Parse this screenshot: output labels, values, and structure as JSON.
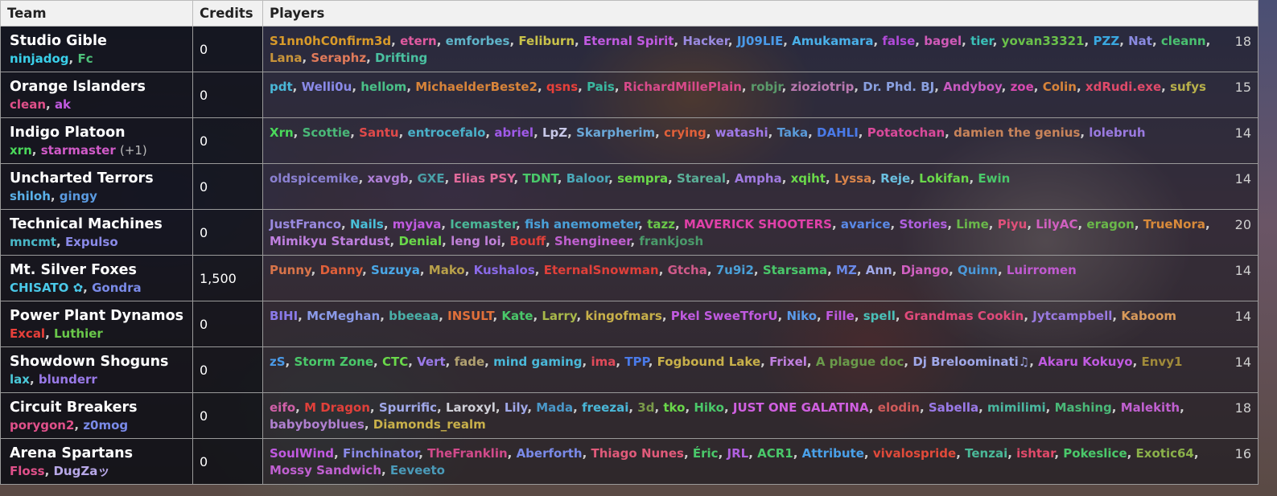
{
  "headers": {
    "team": "Team",
    "credits": "Credits",
    "players": "Players"
  },
  "rows": [
    {
      "team": "Studio Gible",
      "captains": [
        {
          "name": "ninjadog",
          "color": "#3ad0ea"
        },
        {
          "name": "Fc",
          "color": "#4ec07a"
        }
      ],
      "credits": "0",
      "players": [
        {
          "name": "S1nn0hC0nfirm3d",
          "color": "#d89a2a"
        },
        {
          "name": "etern",
          "color": "#e05aa0"
        },
        {
          "name": "emforbes",
          "color": "#5fb3c8"
        },
        {
          "name": "Feliburn",
          "color": "#c9c24a"
        },
        {
          "name": "Eternal Spirit",
          "color": "#c05ae0"
        },
        {
          "name": "Hacker",
          "color": "#9a8ae0"
        },
        {
          "name": "JJ09LIE",
          "color": "#4a9ae8"
        },
        {
          "name": "Amukamara",
          "color": "#4ab0e8"
        },
        {
          "name": "false",
          "color": "#b04ad8"
        },
        {
          "name": "bagel",
          "color": "#d05ab8"
        },
        {
          "name": "tier",
          "color": "#3ac0b8"
        },
        {
          "name": "yovan33321",
          "color": "#6ac04a"
        },
        {
          "name": "PZZ",
          "color": "#3aa8e0"
        },
        {
          "name": "Nat",
          "color": "#8a8ae0"
        },
        {
          "name": "cleann",
          "color": "#4ac070"
        },
        {
          "name": "Lana",
          "color": "#c8943a"
        },
        {
          "name": "Seraphz",
          "color": "#e07a5a"
        },
        {
          "name": "Drifting",
          "color": "#4ac0a0"
        }
      ],
      "count": "18"
    },
    {
      "team": "Orange Islanders",
      "captains": [
        {
          "name": "clean",
          "color": "#e0508a"
        },
        {
          "name": "ak",
          "color": "#c05ae0"
        }
      ],
      "credits": "0",
      "players": [
        {
          "name": "pdt",
          "color": "#4ab8d8"
        },
        {
          "name": "Welli0u",
          "color": "#8a8ae8"
        },
        {
          "name": "hellom",
          "color": "#4ac088"
        },
        {
          "name": "MichaelderBeste2",
          "color": "#d8843a"
        },
        {
          "name": "qsns",
          "color": "#e8403a"
        },
        {
          "name": "Pais",
          "color": "#3ab8a0"
        },
        {
          "name": "RichardMillePlain",
          "color": "#d84a8a"
        },
        {
          "name": "robjr",
          "color": "#5a9a6a"
        },
        {
          "name": "zioziotrip",
          "color": "#b878b0"
        },
        {
          "name": "Dr. Phd. BJ",
          "color": "#8aa0e0"
        },
        {
          "name": "Andyboy",
          "color": "#c85ac0"
        },
        {
          "name": "zoe",
          "color": "#d84ab0"
        },
        {
          "name": "Colin",
          "color": "#d8843a"
        },
        {
          "name": "xdRudi.exe",
          "color": "#e04a6a"
        },
        {
          "name": "sufys",
          "color": "#b8b04a"
        }
      ],
      "count": "15"
    },
    {
      "team": "Indigo Platoon",
      "captains": [
        {
          "name": "xrn",
          "color": "#4ad85a"
        },
        {
          "name": "starmaster",
          "color": "#d05ac8"
        }
      ],
      "captains_extra": "(+1)",
      "credits": "0",
      "players": [
        {
          "name": "Xrn",
          "color": "#4ad85a"
        },
        {
          "name": "Scottie",
          "color": "#4ab878"
        },
        {
          "name": "Santu",
          "color": "#e04a4a"
        },
        {
          "name": "entrocefalo",
          "color": "#4ab0c8"
        },
        {
          "name": "abriel",
          "color": "#a05ae8"
        },
        {
          "name": "LpZ",
          "color": "#c8c8e8"
        },
        {
          "name": "Skarpherim",
          "color": "#6aa8d8"
        },
        {
          "name": "crying",
          "color": "#e0603a"
        },
        {
          "name": "watashi",
          "color": "#a07ae8"
        },
        {
          "name": "Taka",
          "color": "#5a9ad8"
        },
        {
          "name": "DAHLI",
          "color": "#4a7ae8"
        },
        {
          "name": "Potatochan",
          "color": "#d84a9a"
        },
        {
          "name": "damien the genius",
          "color": "#c8845a"
        },
        {
          "name": "lolebruh",
          "color": "#9a7ae0"
        }
      ],
      "count": "14"
    },
    {
      "team": "Uncharted Terrors",
      "captains": [
        {
          "name": "shiloh",
          "color": "#5ab0e8"
        },
        {
          "name": "gingy",
          "color": "#5a9ae0"
        }
      ],
      "credits": "0",
      "players": [
        {
          "name": "oldspicemike",
          "color": "#8a80d0"
        },
        {
          "name": "xavgb",
          "color": "#b080d8"
        },
        {
          "name": "GXE",
          "color": "#4aa0a8"
        },
        {
          "name": "Elias PSY",
          "color": "#e06a9a"
        },
        {
          "name": "TDNT",
          "color": "#4ac86a"
        },
        {
          "name": "Baloor",
          "color": "#4aa8b8"
        },
        {
          "name": "sempra",
          "color": "#6ad84a"
        },
        {
          "name": "Stareal",
          "color": "#5ab098"
        },
        {
          "name": "Ampha",
          "color": "#a07ae0"
        },
        {
          "name": "xqiht",
          "color": "#6ad84a"
        },
        {
          "name": "Lyssa",
          "color": "#d8844a"
        },
        {
          "name": "Reje",
          "color": "#6ac0e0"
        },
        {
          "name": "Lokifan",
          "color": "#6ad84a"
        },
        {
          "name": "Ewin",
          "color": "#4ac86a"
        }
      ],
      "count": "14"
    },
    {
      "team": "Technical Machines",
      "captains": [
        {
          "name": "mncmt",
          "color": "#4ab8c8"
        },
        {
          "name": "Expulso",
          "color": "#8a8ae8"
        }
      ],
      "credits": "0",
      "players": [
        {
          "name": "JustFranco",
          "color": "#9a8ae0"
        },
        {
          "name": "Nails",
          "color": "#4ac0d8"
        },
        {
          "name": "myjava",
          "color": "#c05ae0"
        },
        {
          "name": "Icemaster",
          "color": "#4ab898"
        },
        {
          "name": "fish anemometer",
          "color": "#4aa0d8"
        },
        {
          "name": "tazz",
          "color": "#6ac84a"
        },
        {
          "name": "MAVERICK SHOOTERS",
          "color": "#e040a8"
        },
        {
          "name": "avarice",
          "color": "#5a8ae8"
        },
        {
          "name": "Stories",
          "color": "#b060e0"
        },
        {
          "name": "Lime",
          "color": "#6ab84a"
        },
        {
          "name": "Piyu",
          "color": "#e0507a"
        },
        {
          "name": "LilyAC",
          "color": "#d060c0"
        },
        {
          "name": "eragon",
          "color": "#6ab84a"
        },
        {
          "name": "TrueNora",
          "color": "#d88a3a"
        },
        {
          "name": "Mimikyu Stardust",
          "color": "#c080e0"
        },
        {
          "name": "Denial",
          "color": "#6ad84a"
        },
        {
          "name": "leng loi",
          "color": "#c080d8"
        },
        {
          "name": "Bouff",
          "color": "#e0403a"
        },
        {
          "name": "Shengineer",
          "color": "#c060d0"
        },
        {
          "name": "frankjosh",
          "color": "#4a9a6a"
        }
      ],
      "count": "20"
    },
    {
      "team": "Mt. Silver Foxes",
      "captains": [
        {
          "name": "CHISATO ✿",
          "color": "#4ac8e8"
        },
        {
          "name": "Gondra",
          "color": "#7a8ae8"
        }
      ],
      "credits": "1,500",
      "players": [
        {
          "name": "Punny",
          "color": "#d8744a"
        },
        {
          "name": "Danny",
          "color": "#e0603a"
        },
        {
          "name": "Suzuya",
          "color": "#4aa8e8"
        },
        {
          "name": "Mako",
          "color": "#b8a04a"
        },
        {
          "name": "Kushalos",
          "color": "#8a6ae8"
        },
        {
          "name": "EternalSnowman",
          "color": "#e0403a"
        },
        {
          "name": "Gtcha",
          "color": "#d05a8a"
        },
        {
          "name": "7u9i2",
          "color": "#4aa0d8"
        },
        {
          "name": "Starsama",
          "color": "#4ac86a"
        },
        {
          "name": "MZ",
          "color": "#6a8ae8"
        },
        {
          "name": "Ann",
          "color": "#a0a8e8"
        },
        {
          "name": "Django",
          "color": "#d060c0"
        },
        {
          "name": "Quinn",
          "color": "#4a98d8"
        },
        {
          "name": "Luirromen",
          "color": "#c05ad0"
        }
      ],
      "count": "14"
    },
    {
      "team": "Power Plant Dynamos",
      "captains": [
        {
          "name": "Excal",
          "color": "#e8403a"
        },
        {
          "name": "Luthier",
          "color": "#6ac84a"
        }
      ],
      "credits": "0",
      "players": [
        {
          "name": "BIHI",
          "color": "#8a7ae8"
        },
        {
          "name": "McMeghan",
          "color": "#8a9ae8"
        },
        {
          "name": "bbeeaa",
          "color": "#4ab0a8"
        },
        {
          "name": "INSULT",
          "color": "#e0703a"
        },
        {
          "name": "Kate",
          "color": "#4ac86a"
        },
        {
          "name": "Larry",
          "color": "#a8b84a"
        },
        {
          "name": "kingofmars",
          "color": "#c8b04a"
        },
        {
          "name": "Pkel SweeTforU",
          "color": "#c05ae0"
        },
        {
          "name": "Niko",
          "color": "#5a9ae8"
        },
        {
          "name": "Fille",
          "color": "#c05ae0"
        },
        {
          "name": "spell",
          "color": "#4ac0b8"
        },
        {
          "name": "Grandmas Cookin",
          "color": "#e04a7a"
        },
        {
          "name": "Jytcampbell",
          "color": "#9a7ae0"
        },
        {
          "name": "Kaboom",
          "color": "#d89a5a"
        }
      ],
      "count": "14"
    },
    {
      "team": "Showdown Shoguns",
      "captains": [
        {
          "name": "lax",
          "color": "#4ac8d8"
        },
        {
          "name": "blunderr",
          "color": "#9a7ae8"
        }
      ],
      "credits": "0",
      "players": [
        {
          "name": "zS",
          "color": "#4a9ae8"
        },
        {
          "name": "Storm Zone",
          "color": "#4ac86a"
        },
        {
          "name": "CTC",
          "color": "#6ad84a"
        },
        {
          "name": "Vert",
          "color": "#9a7ae8"
        },
        {
          "name": "fade",
          "color": "#b0a070"
        },
        {
          "name": "mind gaming",
          "color": "#4ab8d8"
        },
        {
          "name": "ima",
          "color": "#e04a5a"
        },
        {
          "name": "TPP",
          "color": "#4a7ae8"
        },
        {
          "name": "Fogbound Lake",
          "color": "#c8b04a"
        },
        {
          "name": "Frixel",
          "color": "#c080e0"
        },
        {
          "name": "A plague doc",
          "color": "#6a9a4a"
        },
        {
          "name": "Dj Breloominati♫",
          "color": "#a0a8e8"
        },
        {
          "name": "Akaru Kokuyo",
          "color": "#c05ae0"
        },
        {
          "name": "Envy1",
          "color": "#a08a3a"
        }
      ],
      "count": "14"
    },
    {
      "team": "Circuit Breakers",
      "captains": [
        {
          "name": "porygon2",
          "color": "#e0508a"
        },
        {
          "name": "z0mog",
          "color": "#7a8ae8"
        }
      ],
      "credits": "0",
      "players": [
        {
          "name": "eifo",
          "color": "#d060a8"
        },
        {
          "name": "M Dragon",
          "color": "#e0403a"
        },
        {
          "name": "Spurrific",
          "color": "#a0a8e8"
        },
        {
          "name": "Laroxyl",
          "color": "#d0d0d8"
        },
        {
          "name": "Lily",
          "color": "#a0a8e8"
        },
        {
          "name": "Mada",
          "color": "#4a98c8"
        },
        {
          "name": "freezai",
          "color": "#4ab8d8"
        },
        {
          "name": "3d",
          "color": "#7a9a4a"
        },
        {
          "name": "tko",
          "color": "#6ad84a"
        },
        {
          "name": "Hiko",
          "color": "#4ac86a"
        },
        {
          "name": "JUST ONE GALATINA",
          "color": "#d060e0"
        },
        {
          "name": "elodin",
          "color": "#d05a5a"
        },
        {
          "name": "Sabella",
          "color": "#9a7ae8"
        },
        {
          "name": "mimilimi",
          "color": "#4ab8a0"
        },
        {
          "name": "Mashing",
          "color": "#4ab878"
        },
        {
          "name": "Malekith",
          "color": "#c060d0"
        },
        {
          "name": "babyboyblues",
          "color": "#b080d0"
        },
        {
          "name": "Diamonds_realm",
          "color": "#c8b04a"
        }
      ],
      "count": "18"
    },
    {
      "team": "Arena Spartans",
      "captains": [
        {
          "name": "Floss",
          "color": "#e0508a"
        },
        {
          "name": "DugZaッ",
          "color": "#b8a8e8"
        }
      ],
      "credits": "0",
      "players": [
        {
          "name": "SoulWind",
          "color": "#c05ae0"
        },
        {
          "name": "Finchinator",
          "color": "#8a8ae8"
        },
        {
          "name": "TheFranklin",
          "color": "#d04a8a"
        },
        {
          "name": "Aberforth",
          "color": "#7a8ae8"
        },
        {
          "name": "Thiago Nunes",
          "color": "#e05a7a"
        },
        {
          "name": "Éric",
          "color": "#4ac86a"
        },
        {
          "name": "JRL",
          "color": "#b060e0"
        },
        {
          "name": "ACR1",
          "color": "#4ac86a"
        },
        {
          "name": "Attribute",
          "color": "#4aa0e8"
        },
        {
          "name": "vivalospride",
          "color": "#e04a3a"
        },
        {
          "name": "Tenzai",
          "color": "#4ab898"
        },
        {
          "name": "ishtar",
          "color": "#e04a6a"
        },
        {
          "name": "Pokeslice",
          "color": "#4ac86a"
        },
        {
          "name": "Exotic64",
          "color": "#8ab04a"
        },
        {
          "name": "Mossy Sandwich",
          "color": "#c060d0"
        },
        {
          "name": "Eeveeto",
          "color": "#4a9ab8"
        }
      ],
      "count": "16"
    }
  ]
}
